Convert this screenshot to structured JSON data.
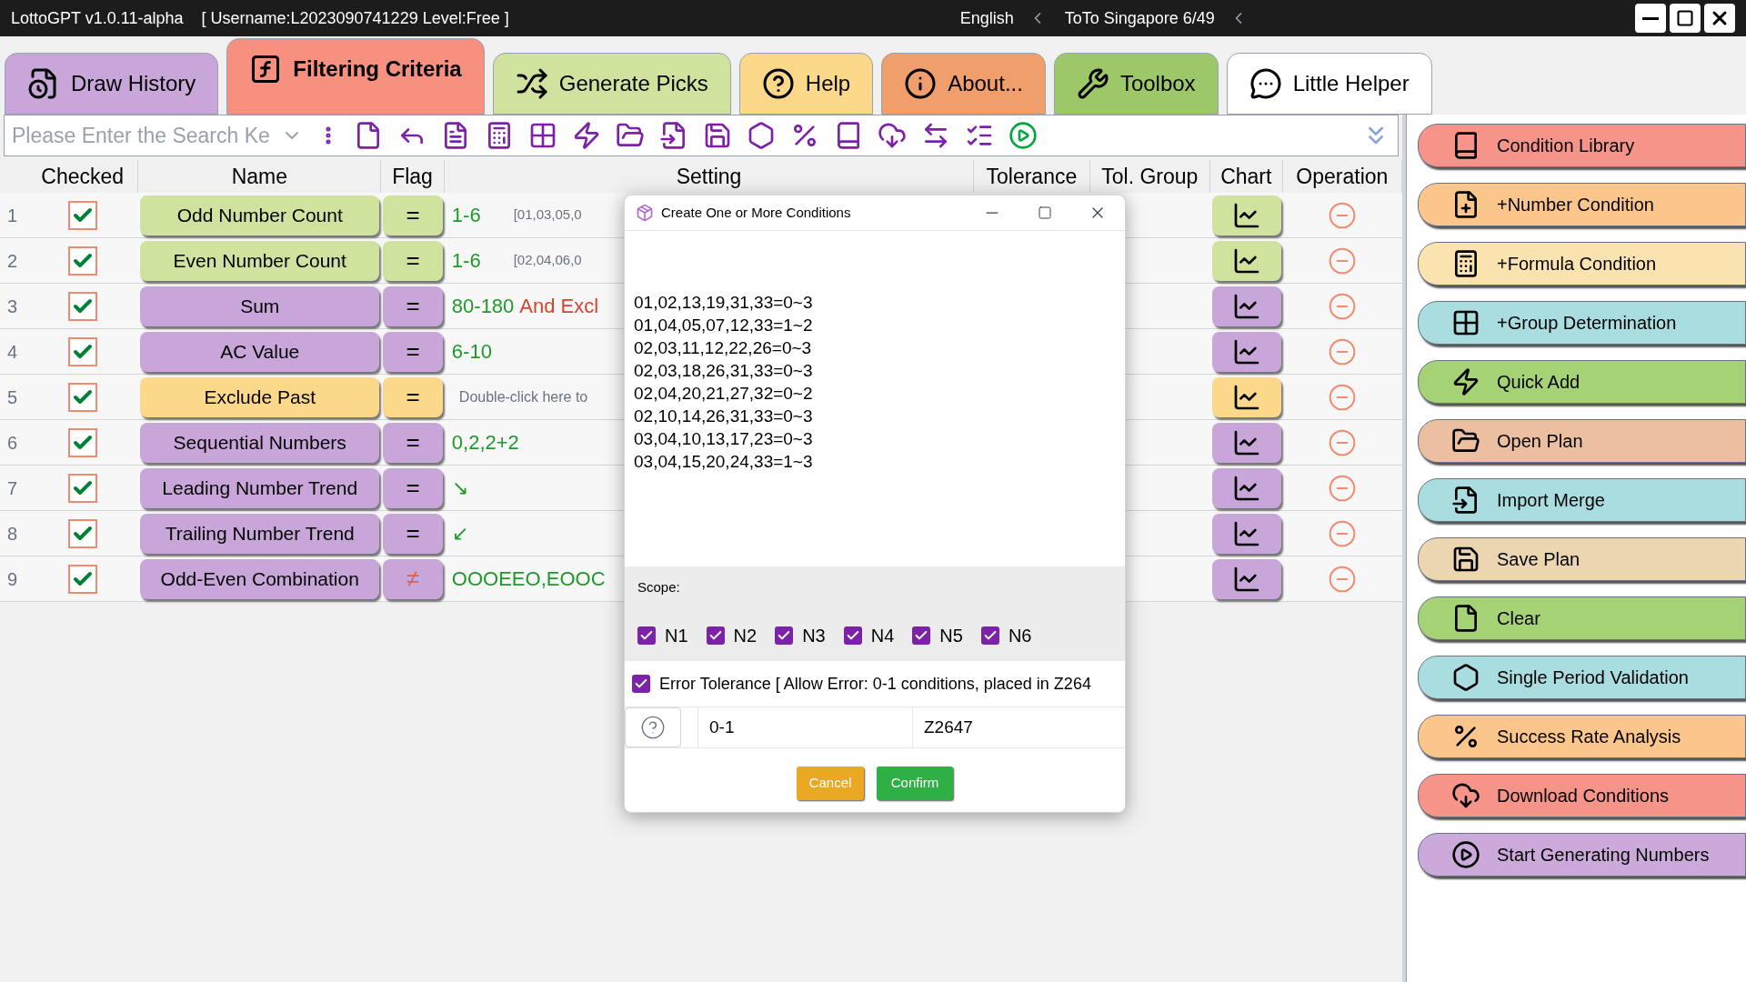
{
  "window": {
    "title": "LottoGPT v1.0.11-alpha",
    "user_info": "[ Username:L2023090741229  Level:Free ]",
    "language": "English",
    "lottery": "ToTo Singapore 6/49"
  },
  "tabs": [
    {
      "label": "Draw History",
      "selected": false,
      "color": "#c9a6d9"
    },
    {
      "label": "Filtering Criteria",
      "selected": true,
      "color": "#f7907f"
    },
    {
      "label": "Generate Picks",
      "selected": false,
      "color": "#cfe39f"
    },
    {
      "label": "Help",
      "selected": false,
      "color": "#fcd98a"
    },
    {
      "label": "About...",
      "selected": false,
      "color": "#ef9e6c"
    },
    {
      "label": "Toolbox",
      "selected": false,
      "color": "#9dc86a"
    },
    {
      "label": "Little Helper",
      "selected": false,
      "color": "#ffffff"
    }
  ],
  "search": {
    "placeholder": "Please Enter the Search Ke"
  },
  "table": {
    "columns": [
      "Checked",
      "Name",
      "Flag",
      "Setting",
      "Tolerance",
      "Tol. Group",
      "Chart",
      "Operation"
    ],
    "rows": [
      {
        "index": "1",
        "checked": true,
        "name": "Odd Number Count",
        "color": "#cfe39f",
        "flag": "=",
        "negated": false,
        "setting": "1-6",
        "note": "[01,03,05,0"
      },
      {
        "index": "2",
        "checked": true,
        "name": "Even Number Count",
        "color": "#cfe39f",
        "flag": "=",
        "negated": false,
        "setting": "1-6",
        "note": "[02,04,06,0"
      },
      {
        "index": "3",
        "checked": true,
        "name": "Sum",
        "color": "#c9a6d9",
        "flag": "=",
        "negated": false,
        "setting": "80-180",
        "extra": "And Excl"
      },
      {
        "index": "4",
        "checked": true,
        "name": "AC Value",
        "color": "#c9a6d9",
        "flag": "=",
        "negated": false,
        "setting": "6-10"
      },
      {
        "index": "5",
        "checked": true,
        "name": "Exclude Past",
        "color": "#fcd98a",
        "flag": "=",
        "negated": false,
        "hint": "Double-click here to"
      },
      {
        "index": "6",
        "checked": true,
        "name": "Sequential Numbers",
        "color": "#c9a6d9",
        "flag": "=",
        "negated": false,
        "setting": "0,2,2+2"
      },
      {
        "index": "7",
        "checked": true,
        "name": "Leading Number Trend",
        "color": "#c9a6d9",
        "flag": "=",
        "negated": false,
        "setting": "↘"
      },
      {
        "index": "8",
        "checked": true,
        "name": "Trailing Number Trend",
        "color": "#c9a6d9",
        "flag": "=",
        "negated": false,
        "setting": "↙"
      },
      {
        "index": "9",
        "checked": true,
        "name": "Odd-Even Combination",
        "color": "#c9a6d9",
        "flag": "≠",
        "negated": true,
        "setting": "OOOEEO,EOOC"
      }
    ]
  },
  "dialog": {
    "title": "Create One or More Conditions",
    "lines": [
      "01,02,13,19,31,33=0~3",
      "01,04,05,07,12,33=1~2",
      "02,03,11,12,22,26=0~3",
      "02,03,18,26,31,33=0~3",
      "02,04,20,21,27,32=0~2",
      "02,10,14,26,31,33=0~3",
      "03,04,10,13,17,23=0~3",
      "03,04,15,20,24,33=1~3"
    ],
    "scope_label": "Scope:",
    "scope": [
      {
        "label": "N1",
        "checked": true
      },
      {
        "label": "N2",
        "checked": true
      },
      {
        "label": "N3",
        "checked": true
      },
      {
        "label": "N4",
        "checked": true
      },
      {
        "label": "N5",
        "checked": true
      },
      {
        "label": "N6",
        "checked": true
      }
    ],
    "error_tolerance": {
      "label": "Error Tolerance [ Allow Error: 0-1 conditions, placed in Z264",
      "checked": true
    },
    "range_value": "0-1",
    "group_value": "Z2647",
    "buttons": [
      "Cancel",
      "Confirm"
    ]
  },
  "side_buttons": [
    {
      "label": "Condition Library",
      "color": "#f7948a"
    },
    {
      "label": "+Number Condition",
      "color": "#fbc68c"
    },
    {
      "label": "+Formula Condition",
      "color": "#fbe3b0"
    },
    {
      "label": "+Group Determination",
      "color": "#a9dde0"
    },
    {
      "label": "Quick Add",
      "color": "#a6d276"
    },
    {
      "label": "Open Plan",
      "color": "#ebbf9f"
    },
    {
      "label": "Import Merge",
      "color": "#a9dde0"
    },
    {
      "label": "Save Plan",
      "color": "#ecd6b2"
    },
    {
      "label": "Clear",
      "color": "#a6d276"
    },
    {
      "label": "Single Period Validation",
      "color": "#a9dde0"
    },
    {
      "label": "Success Rate Analysis",
      "color": "#fbc68c"
    },
    {
      "label": "Download Conditions",
      "color": "#f7948a"
    },
    {
      "label": "Start Generating Numbers",
      "color": "#cbaadb"
    }
  ]
}
